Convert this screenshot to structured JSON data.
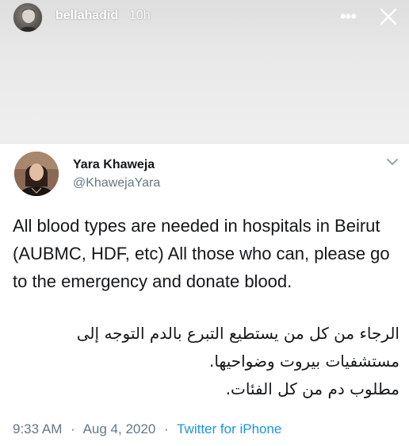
{
  "story": {
    "username": "bellahadid",
    "time_ago": "10h",
    "more_icon": "ellipsis-icon",
    "close_icon": "close-icon"
  },
  "tweet": {
    "author": {
      "name": "Yara Khaweja",
      "handle": "@KhawejaYara"
    },
    "text_en": "All blood types are needed in hospitals in Beirut (AUBMC, HDF, etc) All those who can, please go to the emergency and donate blood.",
    "text_ar": [
      "الرجاء من كل من يستطيع التبرع بالدم التوجه إلى",
      "مستشفيات بيروت وضواحيها.",
      "مطلوب دم من كل الفئات."
    ],
    "time": "9:33 AM",
    "date": "Aug 4, 2020",
    "separator": "·",
    "source": "Twitter for iPhone"
  },
  "colors": {
    "link": "#1b95e0",
    "secondary_text": "#657786",
    "primary_text": "#14171a"
  }
}
